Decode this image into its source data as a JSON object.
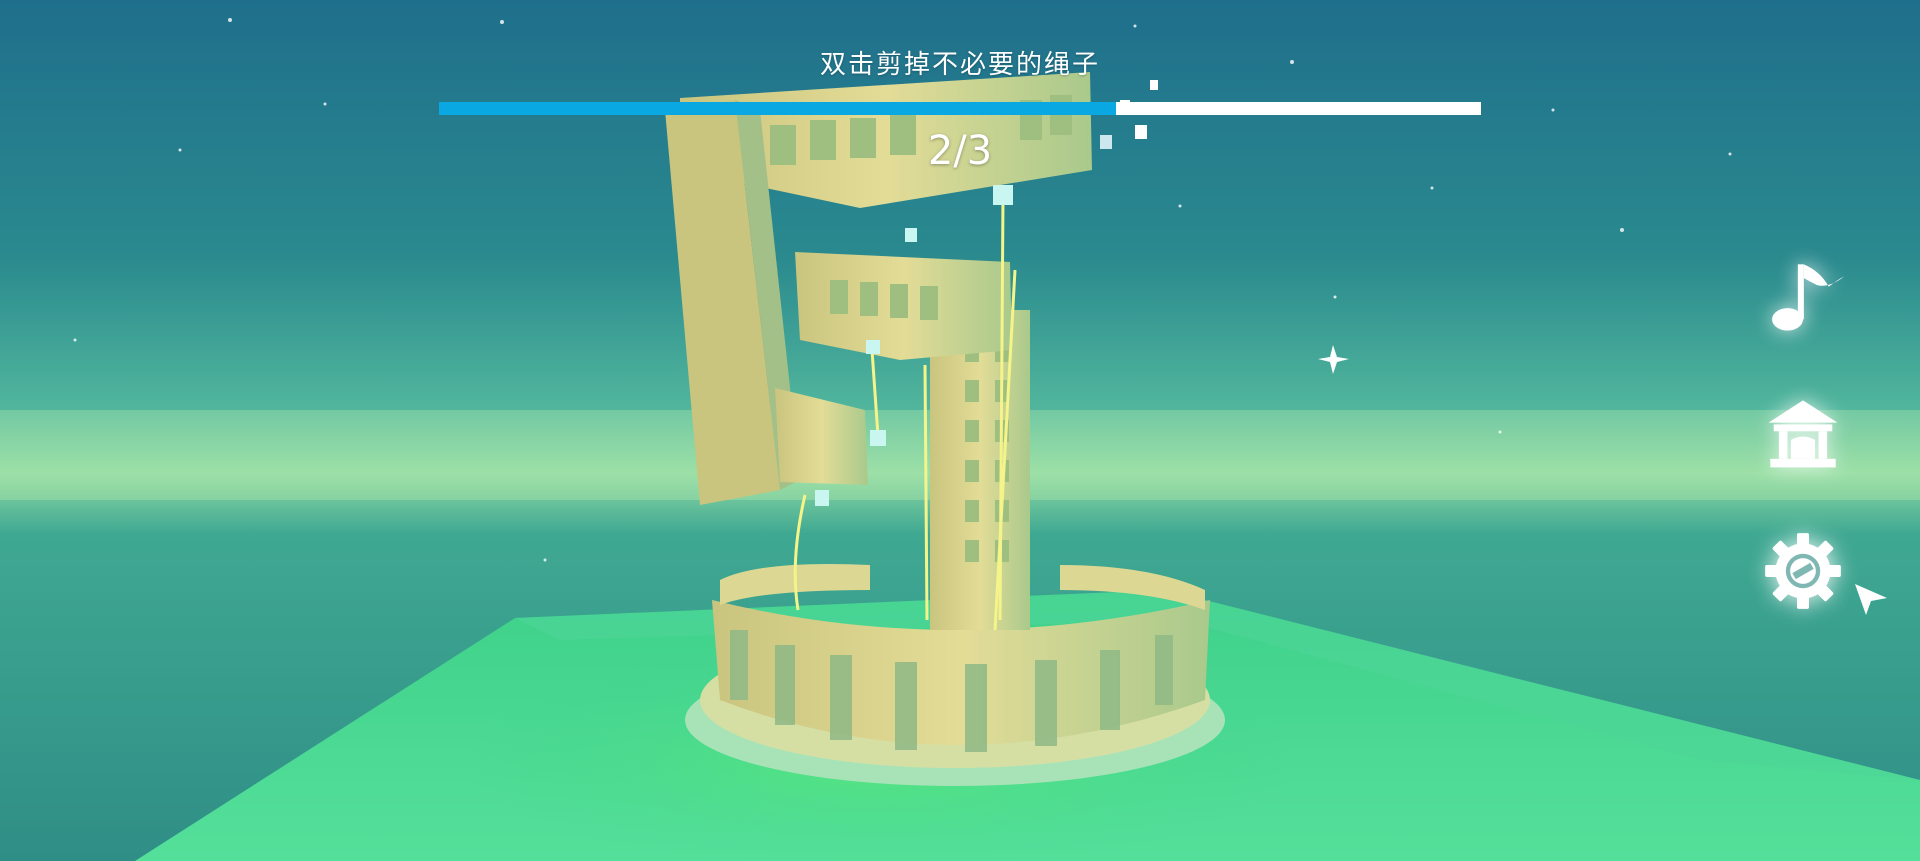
{
  "hud": {
    "hint": "双击剪掉不必要的绳子",
    "progress_fraction": 0.65,
    "progress_fill_color": "#0aa8e3",
    "progress_track_color": "#ffffff",
    "counter": "2/3"
  },
  "side_buttons": [
    {
      "name": "music-button",
      "icon": "music-note-icon"
    },
    {
      "name": "home-button",
      "icon": "temple-icon"
    },
    {
      "name": "settings-button",
      "icon": "gear-icon"
    }
  ]
}
